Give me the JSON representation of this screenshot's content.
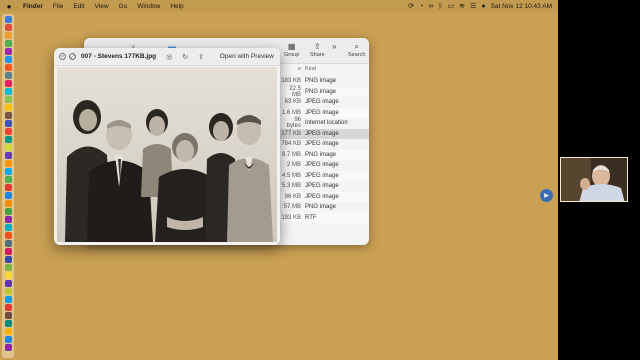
{
  "menubar": {
    "apple_icon": "apple-icon",
    "items": [
      {
        "label": "Finder",
        "bold": true
      },
      {
        "label": "File",
        "bold": false
      },
      {
        "label": "Edit",
        "bold": false
      },
      {
        "label": "View",
        "bold": false
      },
      {
        "label": "Go",
        "bold": false
      },
      {
        "label": "Window",
        "bold": false
      },
      {
        "label": "Help",
        "bold": false
      }
    ],
    "clock": "Sat Nov 12  10:43 AM"
  },
  "finder": {
    "toolbar": {
      "group_label": "Group",
      "share_label": "Share",
      "search_label": "Search"
    },
    "header": {
      "size": "e",
      "kind": "Kind"
    },
    "rows": [
      {
        "size": "183 KB",
        "kind": "PNG image"
      },
      {
        "size": "22.5 MB",
        "kind": "PNG image"
      },
      {
        "size": "63 KB",
        "kind": "JPEG image"
      },
      {
        "size": "1.6 MB",
        "kind": "JPEG image"
      },
      {
        "size": "96 bytes",
        "kind": "Internet location"
      },
      {
        "size": "177 KB",
        "kind": "JPEG image"
      },
      {
        "size": "784 KB",
        "kind": "JPEG image"
      },
      {
        "size": "8.7 MB",
        "kind": "PNG image"
      },
      {
        "size": "2 MB",
        "kind": "JPEG image"
      },
      {
        "size": "4.5 MB",
        "kind": "JPEG image"
      },
      {
        "size": "5.3 MB",
        "kind": "JPEG image"
      },
      {
        "size": "96 KB",
        "kind": "JPEG image"
      },
      {
        "size": "57 MB",
        "kind": "PNG image"
      },
      {
        "size": "193 KB",
        "kind": "RTF"
      }
    ],
    "selected_index": 5
  },
  "preview": {
    "title": "007 - Stevens 177KB.jpg",
    "open_with_label": "Open with Preview"
  },
  "colors": {
    "desktop": "#c9a054",
    "menubar": "#c29a50",
    "selection": "#d6d6d6"
  }
}
